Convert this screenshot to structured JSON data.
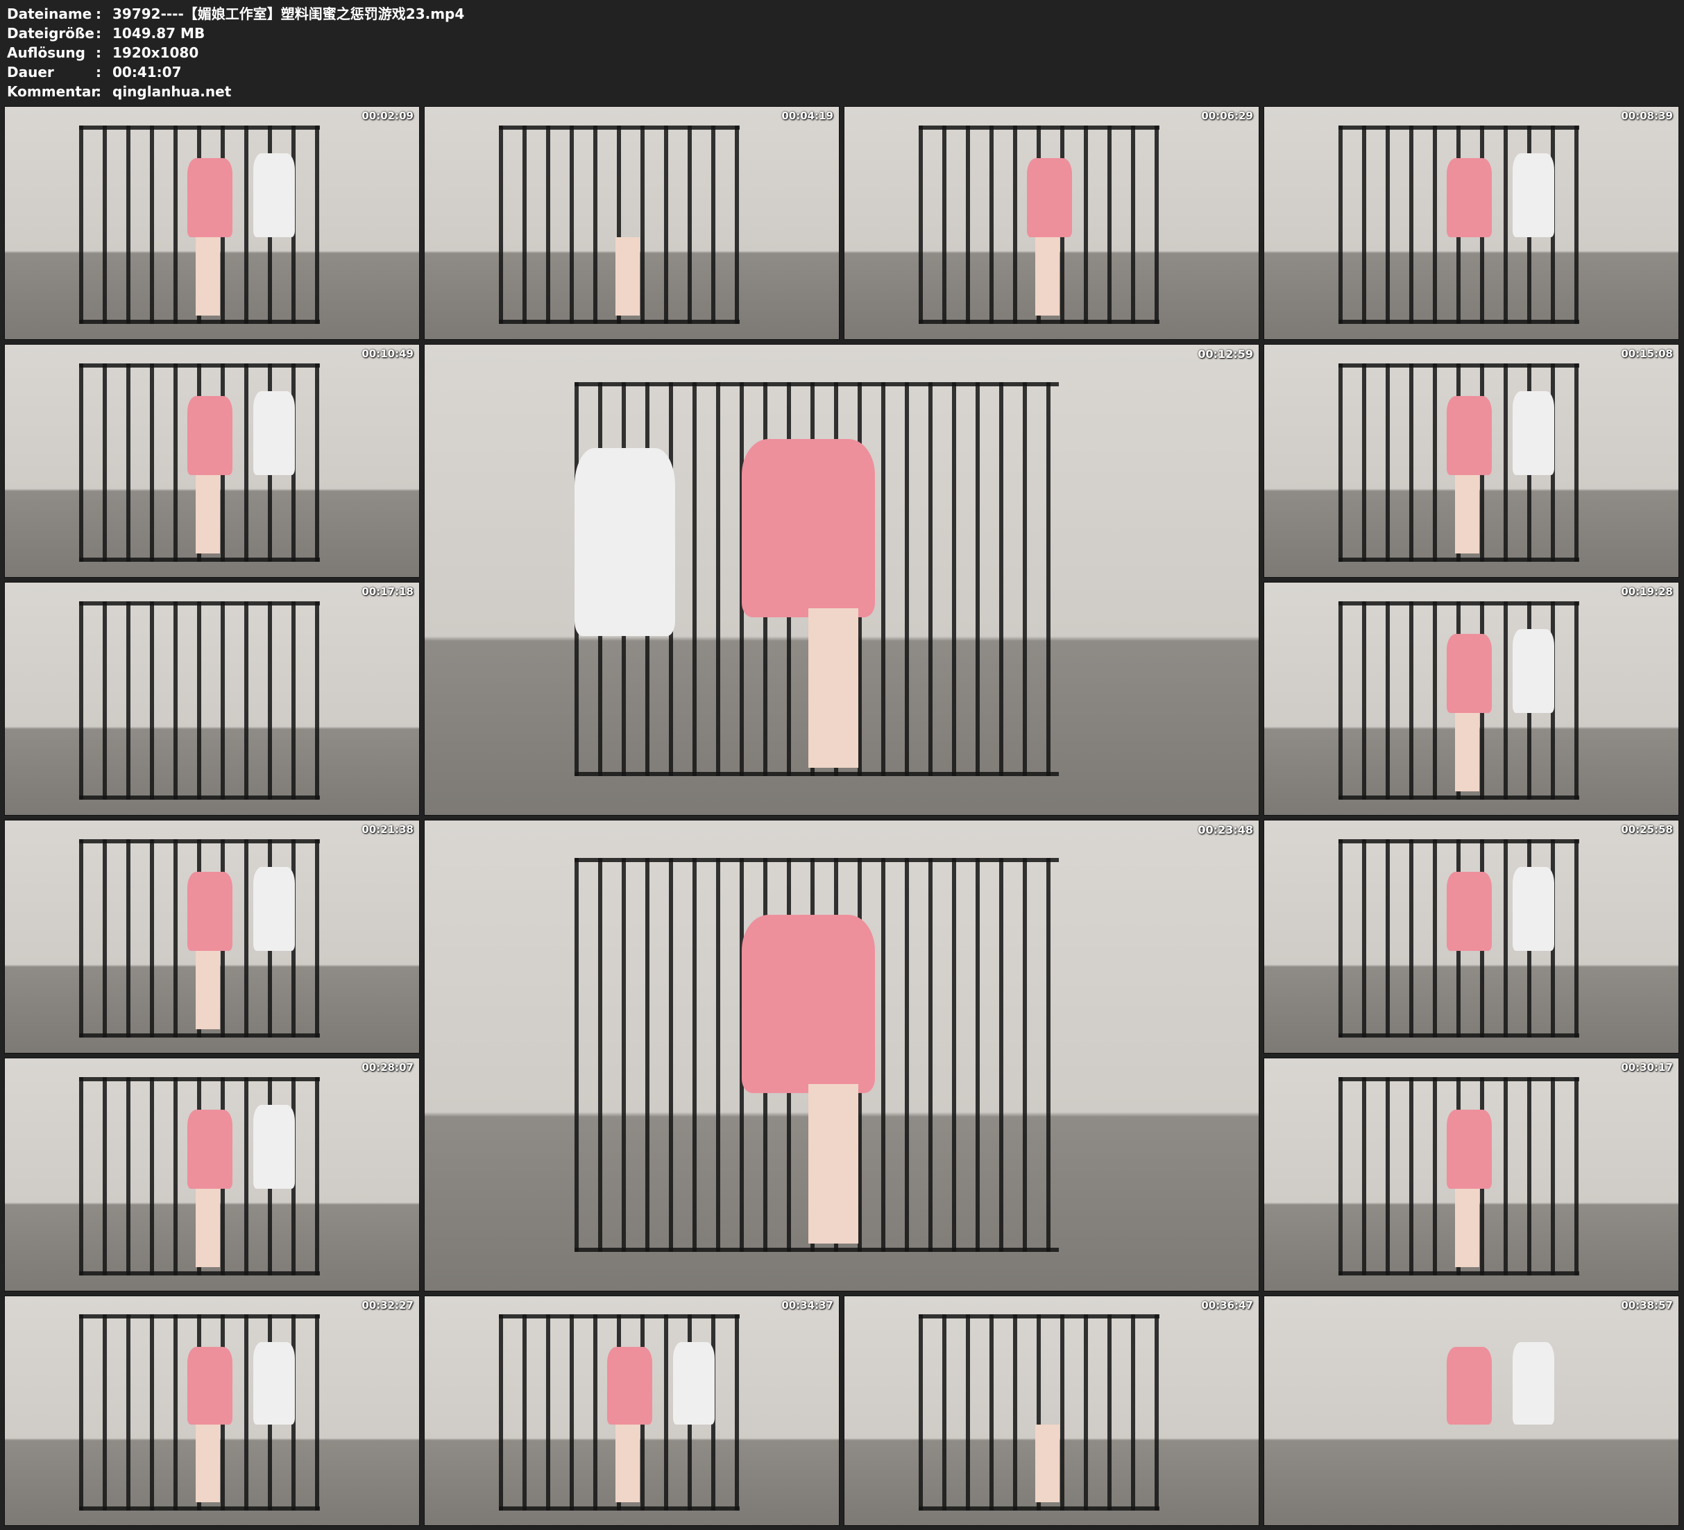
{
  "header": {
    "rows": [
      {
        "label": "Dateiname",
        "sep": ":",
        "value": "39792----【媚娘工作室】塑料闺蜜之惩罚游戏23.mp4"
      },
      {
        "label": "Dateigröße",
        "sep": ":",
        "value": "1049.87 MB"
      },
      {
        "label": "Auflösung",
        "sep": ":",
        "value": "1920x1080"
      },
      {
        "label": "Dauer",
        "sep": ":",
        "value": "00:41:07"
      },
      {
        "label": "Kommentar",
        "sep": ":",
        "value": "qinglanhua.net"
      }
    ]
  },
  "thumbnails": [
    {
      "timestamp": "00:02:09"
    },
    {
      "timestamp": "00:04:19"
    },
    {
      "timestamp": "00:06:29"
    },
    {
      "timestamp": "00:08:39"
    },
    {
      "timestamp": "00:10:49"
    },
    {
      "timestamp": "00:12:59"
    },
    {
      "timestamp": "00:15:08"
    },
    {
      "timestamp": "00:17:18"
    },
    {
      "timestamp": "00:19:28"
    },
    {
      "timestamp": "00:21:38"
    },
    {
      "timestamp": "00:23:48"
    },
    {
      "timestamp": "00:25:58"
    },
    {
      "timestamp": "00:28:07"
    },
    {
      "timestamp": "00:30:17"
    },
    {
      "timestamp": "00:32:27"
    },
    {
      "timestamp": "00:34:37"
    },
    {
      "timestamp": "00:36:47"
    },
    {
      "timestamp": "00:38:57"
    }
  ]
}
